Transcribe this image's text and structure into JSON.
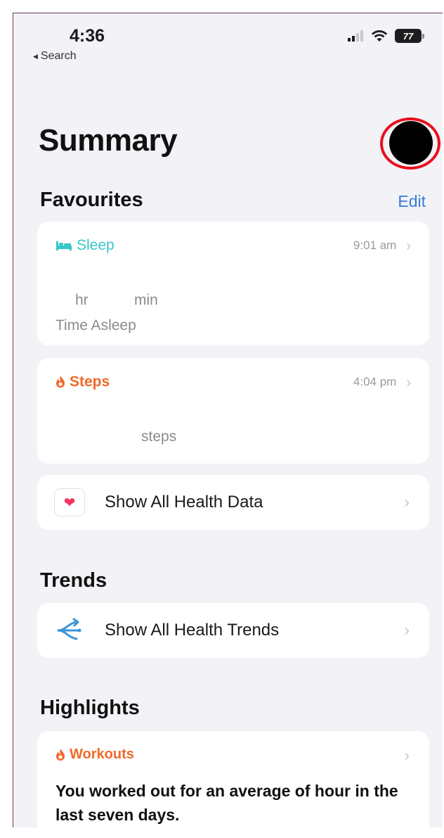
{
  "status_bar": {
    "time": "4:36",
    "back_label": "Search",
    "battery": "77"
  },
  "header": {
    "title": "Summary"
  },
  "favourites": {
    "heading": "Favourites",
    "edit_label": "Edit",
    "sleep": {
      "label": "Sleep",
      "time": "9:01 am",
      "hr_unit": "hr",
      "min_unit": "min",
      "caption": "Time Asleep"
    },
    "steps": {
      "label": "Steps",
      "time": "4:04 pm",
      "unit": "steps"
    },
    "show_all_label": "Show All Health Data"
  },
  "trends": {
    "heading": "Trends",
    "show_all_label": "Show All Health Trends"
  },
  "highlights": {
    "heading": "Highlights",
    "workouts": {
      "label": "Workouts",
      "text": "You worked out for an average of    hour in the last seven days."
    }
  },
  "colors": {
    "sleep_accent": "#38c6c9",
    "activity_accent": "#f0692a",
    "link_blue": "#3a7bd5",
    "heart_pink": "#f4365f",
    "highlight_ring": "#e8101c"
  }
}
